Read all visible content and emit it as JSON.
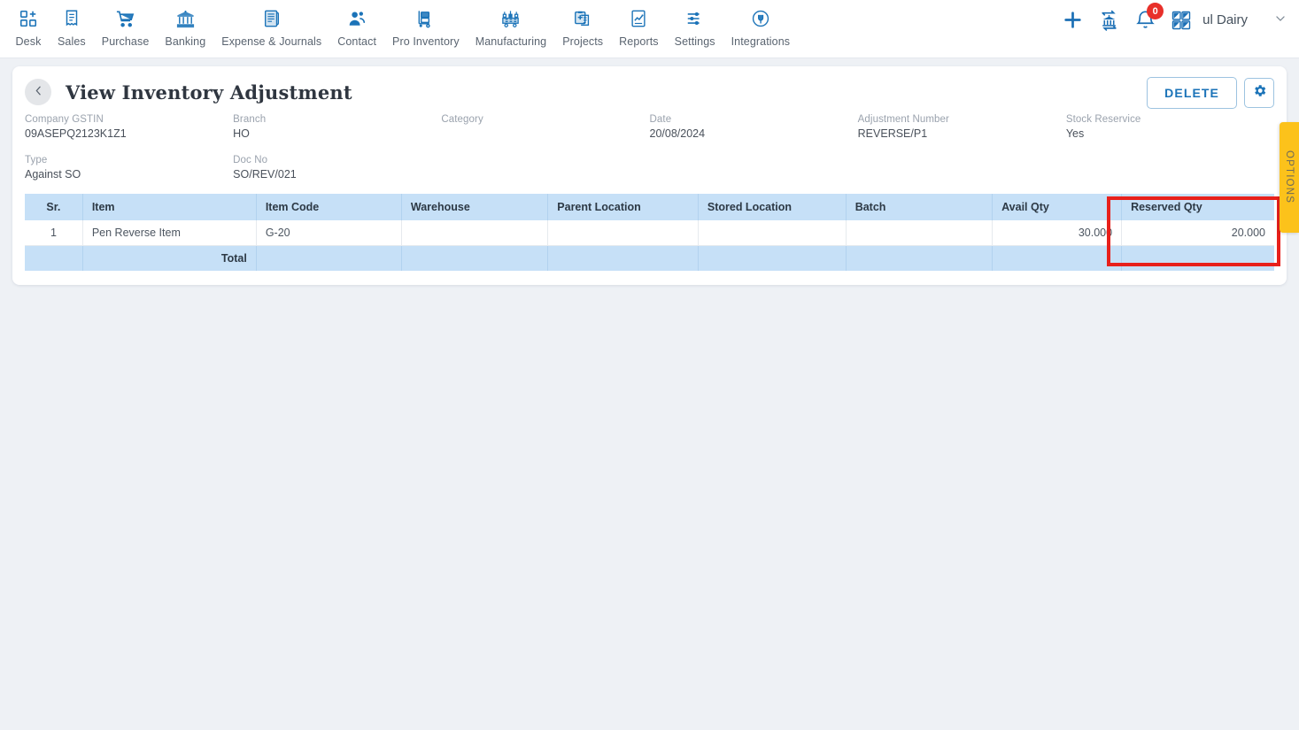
{
  "nav": {
    "items": [
      {
        "label": "Desk",
        "icon": "desk-grid-plus-icon"
      },
      {
        "label": "Sales",
        "icon": "sales-receipt-icon"
      },
      {
        "label": "Purchase",
        "icon": "purchase-cart-icon"
      },
      {
        "label": "Banking",
        "icon": "banking-bank-icon"
      },
      {
        "label": "Expense & Journals",
        "icon": "expense-journal-icon"
      },
      {
        "label": "Contact",
        "icon": "contact-people-icon"
      },
      {
        "label": "Pro Inventory",
        "icon": "pro-inventory-trolley-icon"
      },
      {
        "label": "Manufacturing",
        "icon": "manufacturing-machine-icon"
      },
      {
        "label": "Projects",
        "icon": "projects-clipboard-icon"
      },
      {
        "label": "Reports",
        "icon": "reports-chart-icon"
      },
      {
        "label": "Settings",
        "icon": "settings-sliders-icon"
      },
      {
        "label": "Integrations",
        "icon": "integrations-plug-icon"
      }
    ]
  },
  "header_right": {
    "add_icon": "plus-icon",
    "transfer_icon": "bank-transfer-icon",
    "notification_icon": "bell-icon",
    "notification_count": "0",
    "apps_icon": "apps-grid-icon",
    "company_name": "ul Dairy",
    "dropdown_icon": "chevron-down-icon"
  },
  "page": {
    "back_icon": "chevron-left-icon",
    "title": "View Inventory Adjustment",
    "delete_label": "DELETE",
    "settings_icon": "gear-icon"
  },
  "meta": [
    {
      "label": "Company GSTIN",
      "value": "09ASEPQ2123K1Z1"
    },
    {
      "label": "Branch",
      "value": "HO"
    },
    {
      "label": "Category",
      "value": ""
    },
    {
      "label": "Date",
      "value": "20/08/2024"
    },
    {
      "label": "Adjustment Number",
      "value": "REVERSE/P1"
    },
    {
      "label": "Stock Reservice",
      "value": "Yes"
    },
    {
      "label": "Type",
      "value": "Against SO"
    },
    {
      "label": "Doc No",
      "value": "SO/REV/021"
    },
    {
      "label": "",
      "value": ""
    },
    {
      "label": "",
      "value": ""
    },
    {
      "label": "",
      "value": ""
    },
    {
      "label": "",
      "value": ""
    }
  ],
  "table": {
    "columns": [
      "Sr.",
      "Item",
      "Item Code",
      "Warehouse",
      "Parent Location",
      "Stored Location",
      "Batch",
      "Avail Qty",
      "Reserved Qty"
    ],
    "rows": [
      {
        "sr": "1",
        "item": "Pen Reverse Item",
        "item_code": "G-20",
        "warehouse": "",
        "parent_location": "",
        "stored_location": "",
        "batch": "",
        "avail_qty": "30.000",
        "reserved_qty": "20.000"
      }
    ],
    "total_label": "Total",
    "total_values": {
      "avail_qty": "",
      "reserved_qty": ""
    }
  },
  "options_tab": {
    "label": "OPTIONS"
  },
  "annotation": {
    "color": "#e8201b",
    "target": "reserved-qty-column"
  }
}
